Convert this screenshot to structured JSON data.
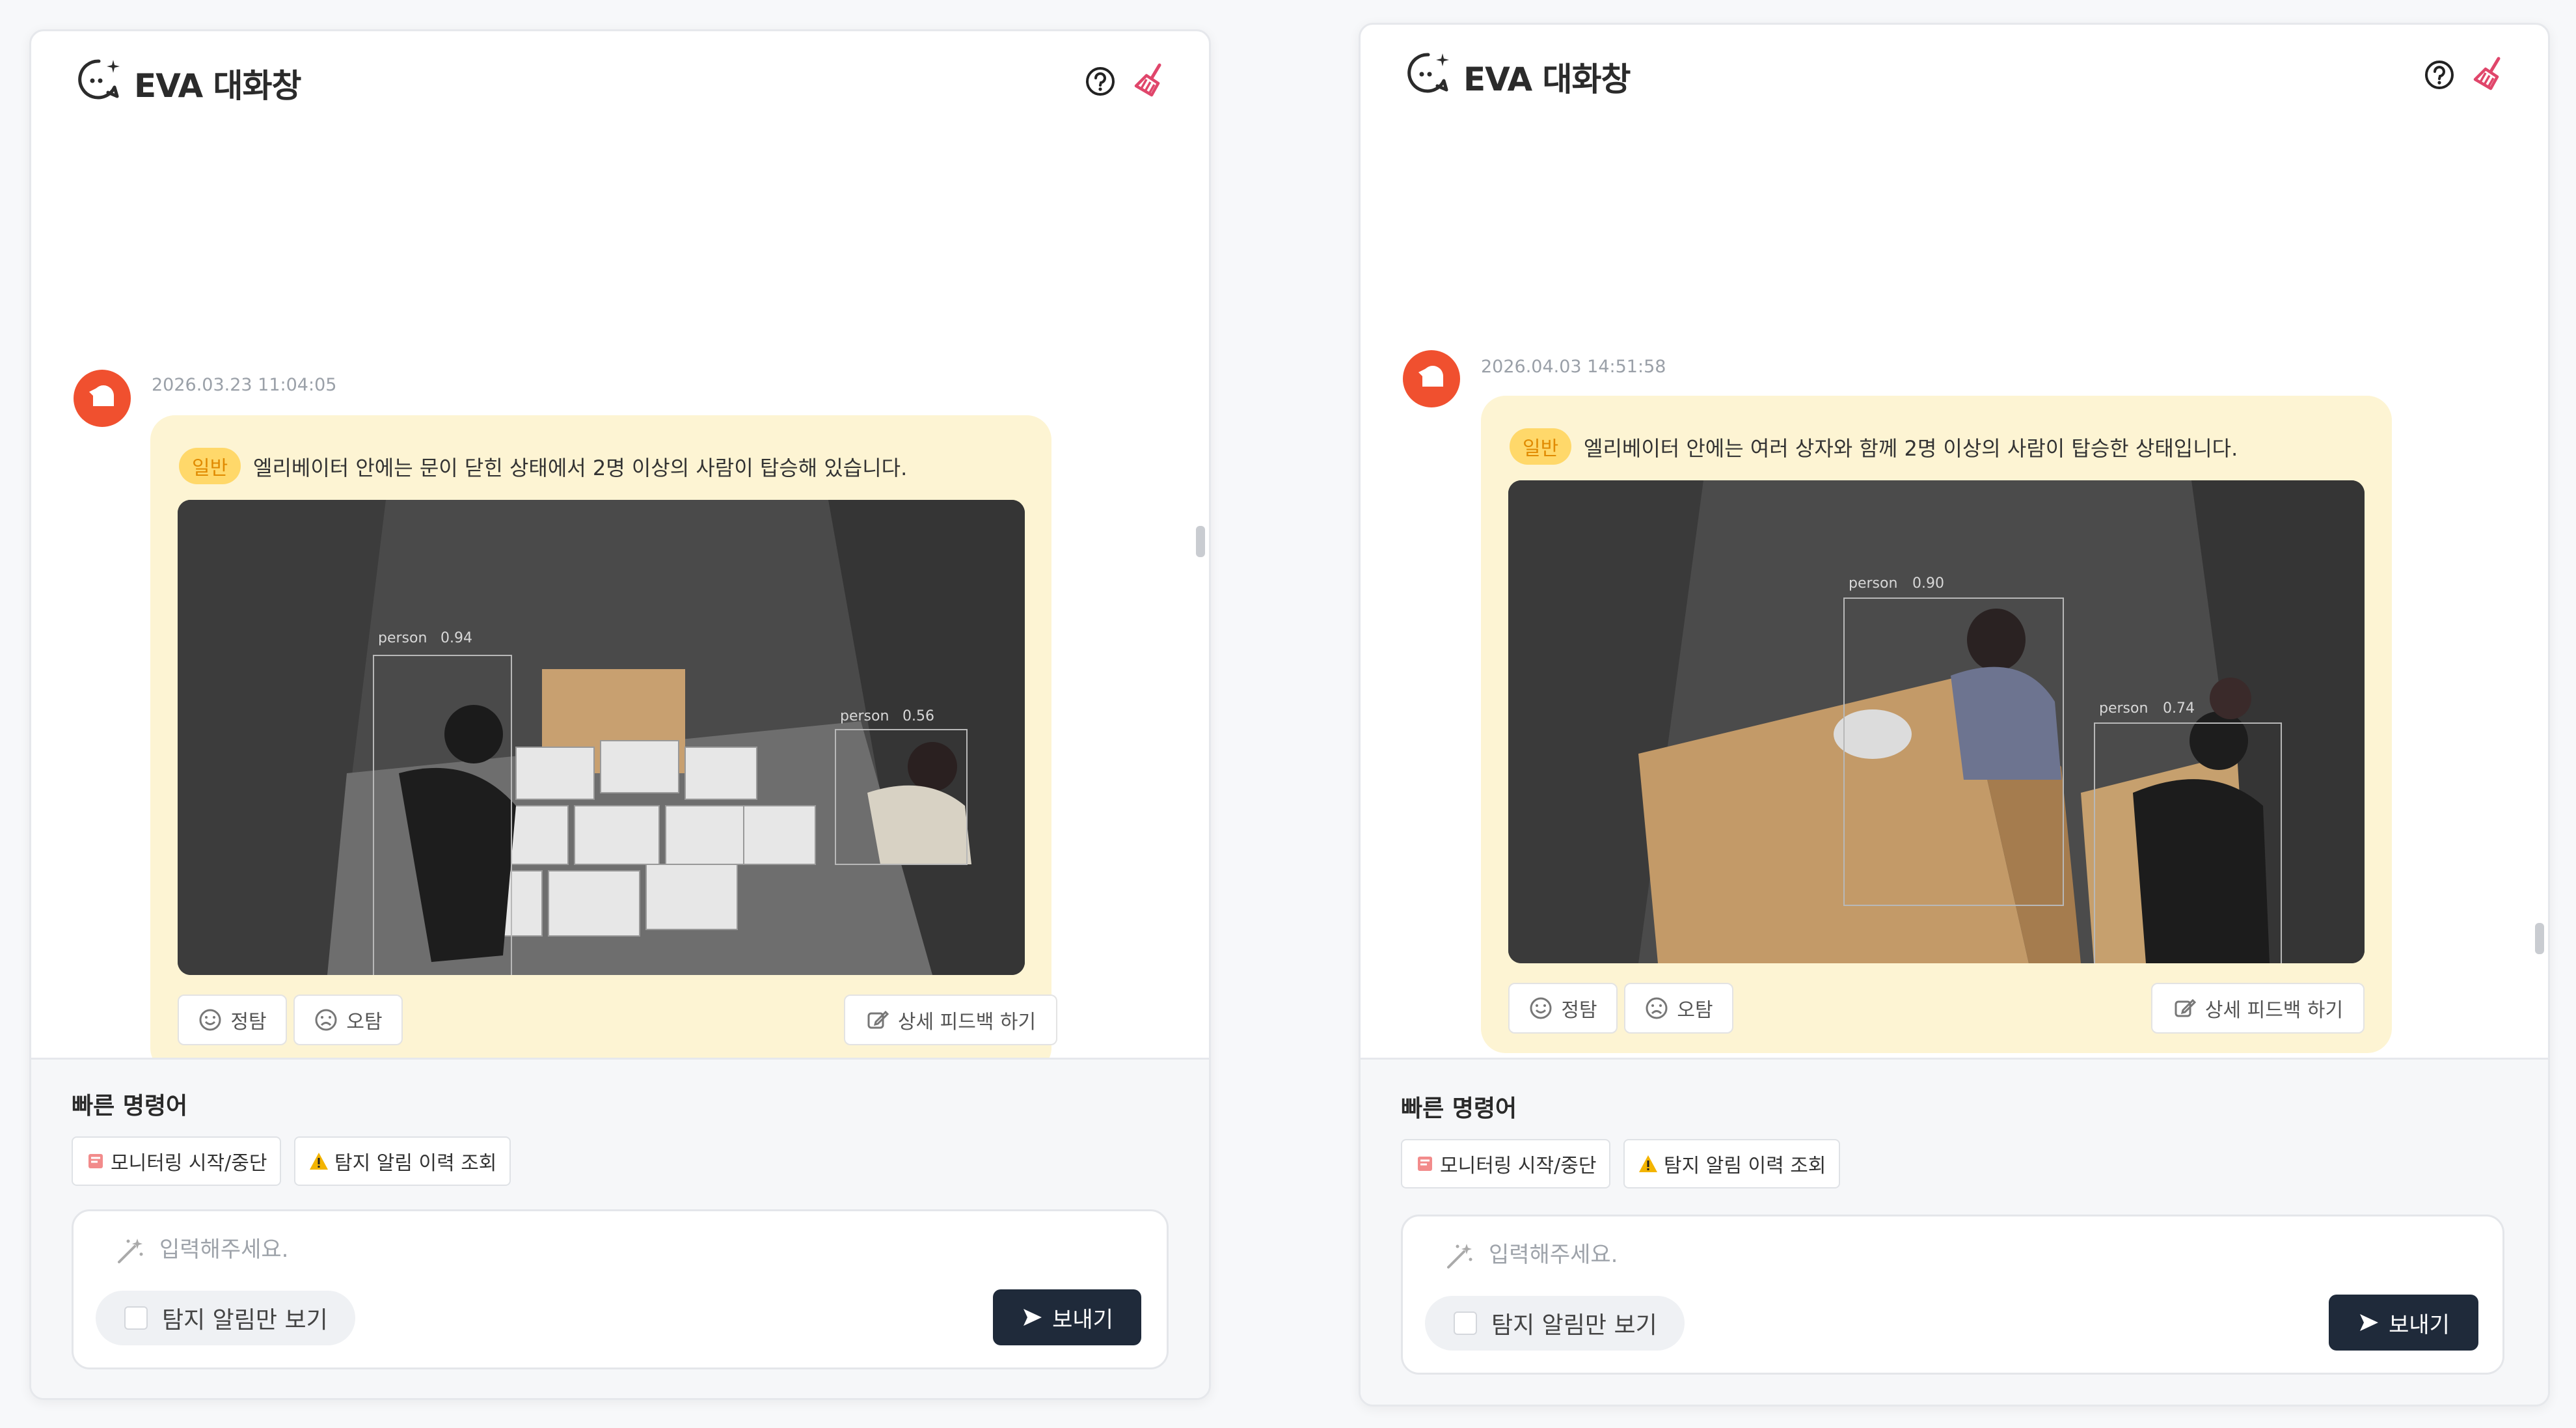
{
  "panels": [
    {
      "title": "EVA 대화창",
      "message": {
        "timestamp": "2026.03.23 11:04:05",
        "tag": "일반",
        "text": "엘리베이터 안에는 문이 닫힌 상태에서 2명 이상의 사람이 탑승해 있습니다.",
        "detections": [
          {
            "label": "person",
            "score": "0.94"
          },
          {
            "label": "person",
            "score": "0.56"
          }
        ],
        "correct_label": "정탐",
        "wrong_label": "오탐",
        "detail_feedback_label": "상세 피드백 하기"
      },
      "quick": {
        "title": "빠른 명령어",
        "monitor_label": "모니터링 시작/중단",
        "history_label": "탐지 알림 이력 조회"
      },
      "input": {
        "placeholder": "입력해주세요.",
        "toggle_label": "탐지 알림만 보기",
        "send_label": "보내기"
      }
    },
    {
      "title": "EVA 대화창",
      "message": {
        "timestamp": "2026.04.03 14:51:58",
        "tag": "일반",
        "text": "엘리베이터 안에는 여러 상자와 함께 2명 이상의 사람이 탑승한 상태입니다.",
        "detections": [
          {
            "label": "person",
            "score": "0.90"
          },
          {
            "label": "person",
            "score": "0.74"
          }
        ],
        "correct_label": "정탐",
        "wrong_label": "오탐",
        "detail_feedback_label": "상세 피드백 하기"
      },
      "quick": {
        "title": "빠른 명령어",
        "monitor_label": "모니터링 시작/중단",
        "history_label": "탐지 알림 이력 조회"
      },
      "input": {
        "placeholder": "입력해주세요.",
        "toggle_label": "탐지 알림만 보기",
        "send_label": "보내기"
      }
    }
  ],
  "icons": {
    "chat": "chat-sparkle-icon",
    "help": "help-circle-icon",
    "clear": "broom-icon",
    "avatar": "bot-avatar",
    "correct": "smile-icon",
    "wrong": "frown-icon",
    "detail": "edit-icon",
    "monitor": "monitor-sticker-icon",
    "warning": "warning-icon",
    "wand": "magic-wand-icon",
    "send": "send-arrow-icon"
  },
  "colors": {
    "accent": "#f0502f",
    "bubble": "#fdf4d3",
    "tag_bg": "#ffd86a",
    "tag_text": "#e08a00",
    "send_button": "#1f2a3a",
    "detection_box": "#b8b8b8"
  }
}
